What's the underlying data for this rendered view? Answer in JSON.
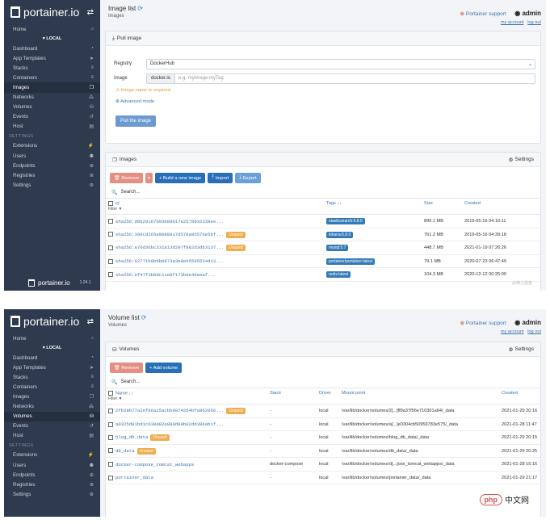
{
  "brand": {
    "name": "portainer.io",
    "version": "1.24.1"
  },
  "sidebar": {
    "items_top": [
      {
        "label": "Home",
        "icon": "home-icon",
        "glyph": "⌂"
      }
    ],
    "local_label": "♥ LOCAL",
    "items_endpoint": [
      {
        "label": "Dashboard",
        "glyph": "◔"
      },
      {
        "label": "App Templates",
        "glyph": "➤"
      },
      {
        "label": "Stacks",
        "glyph": "≡"
      },
      {
        "label": "Containers",
        "glyph": "≡"
      },
      {
        "label": "Images",
        "glyph": "❐"
      },
      {
        "label": "Networks",
        "glyph": "⁂"
      },
      {
        "label": "Volumes",
        "glyph": "⛁"
      },
      {
        "label": "Events",
        "glyph": "↺"
      },
      {
        "label": "Host",
        "glyph": "▤"
      }
    ],
    "settings_section": "SETTINGS",
    "items_settings": [
      {
        "label": "Extensions",
        "glyph": "⚡"
      },
      {
        "label": "Users",
        "glyph": "⚉"
      },
      {
        "label": "Endpoints",
        "glyph": "⊕"
      },
      {
        "label": "Registries",
        "glyph": "≣"
      },
      {
        "label": "Settings",
        "glyph": "⚙"
      }
    ]
  },
  "header": {
    "support": "Portainer support",
    "user": "admin",
    "my_account": "my account",
    "logout": "log out"
  },
  "images_page": {
    "title": "Image list",
    "breadcrumb": "Images",
    "pull": {
      "header": "Pull image",
      "registry_label": "Registry",
      "registry_value": "DockerHub",
      "image_label": "Image",
      "image_prefix": "docker.io",
      "image_placeholder": "e.g. myImage:myTag",
      "warning": "Image name is required.",
      "advanced": "Advanced mode",
      "button": "Pull the image"
    },
    "list": {
      "header": "Images",
      "settings": "Settings",
      "remove": "Remove",
      "build": "+ Build a new image",
      "import": "Import",
      "export": "Export",
      "search_placeholder": "Search...",
      "col_id": "Id",
      "col_filter": "Filter",
      "col_tags": "Tags",
      "col_size": "Size",
      "col_created": "Created",
      "unused_label": "Unused",
      "rows": [
        {
          "id": "sha256:d0b29167093b89017e2578932339ee...",
          "unused": false,
          "tag": "elasticsearch:6.8.0",
          "size": "895.1 MB",
          "created": "2019-05-16 04:10:11"
        },
        {
          "id": "sha256:390cd265e9088917d578a85576e5bf...",
          "unused": true,
          "tag": "kibana:6.8.0",
          "size": "761.2 MB",
          "created": "2019-05-16 04:39:18"
        },
        {
          "id": "sha256:a70d36bc331a13d297f882d3d63137...",
          "unused": true,
          "tag": "mysql:5.7",
          "size": "448.7 MB",
          "created": "2021-01-19 07:26:26"
        },
        {
          "id": "sha256:62771b0b9b0973a3e8e95595534d13...",
          "unused": false,
          "tag": "portainer/portainer:latest",
          "size": "79.1 MB",
          "created": "2020-07-23 06:47:49"
        },
        {
          "id": "sha256:ef47f3b6dc11e8f173b9e46eeaf...",
          "unused": false,
          "tag": "redis:latest",
          "size": "104.3 MB",
          "created": "2020-12-12 00:25:00"
        }
      ],
      "corner_mark": "@稀土掘金"
    }
  },
  "volumes_page": {
    "title": "Volume list",
    "breadcrumb": "Volumes",
    "header": "Volumes",
    "settings": "Settings",
    "remove": "Remove",
    "add": "+ Add volume",
    "search_placeholder": "Search...",
    "col_name": "Name",
    "col_filter": "Filter",
    "col_stack": "Stack",
    "col_driver": "Driver",
    "col_mount": "Mount point",
    "col_created": "Created",
    "unused_label": "Unused",
    "rows": [
      {
        "name": "2fb29b77a2ef6ea25acbb9874264bfa962056...",
        "unused": true,
        "stack": "-",
        "driver": "local",
        "mount": "/var/lib/docker/volumes/2[...]ff9a37f56e710301a64/_data",
        "created": "2021-01-29 20:16"
      },
      {
        "name": "a0325d81bd1c030082a980d89b02dd396ab1f...",
        "unused": false,
        "stack": "-",
        "driver": "local",
        "mount": "/var/lib/docker/volumes/a[...]e0304cb50959783e575/_data",
        "created": "2021-01-28 11:47"
      },
      {
        "name": "blog_db_data",
        "unused": true,
        "stack": "-",
        "driver": "local",
        "mount": "/var/lib/docker/volumes/blog_db_data/_data",
        "created": "2021-01-29 20:15"
      },
      {
        "name": "db_data",
        "unused": true,
        "stack": "-",
        "driver": "local",
        "mount": "/var/lib/docker/volumes/db_data/_data",
        "created": "2021-01-29 20:25"
      },
      {
        "name": "docker-compose_tomcat_webapps",
        "unused": false,
        "stack": "docker-compose",
        "driver": "local",
        "mount": "/var/lib/docker/volumes/d[...]ose_tomcat_webapps/_data",
        "created": "2021-01-28 15:16"
      },
      {
        "name": "portainer_data",
        "unused": false,
        "stack": "-",
        "driver": "local",
        "mount": "/var/lib/docker/volumes/portainer_data/_data",
        "created": "2021-01-29 21:17"
      }
    ],
    "watermark_php": "php",
    "watermark_cn": "中文网"
  },
  "colors": {
    "sidebar": "#2e3a4e",
    "accent": "#286fb8",
    "danger": "#e48e84",
    "warning": "#f0ad4e"
  }
}
